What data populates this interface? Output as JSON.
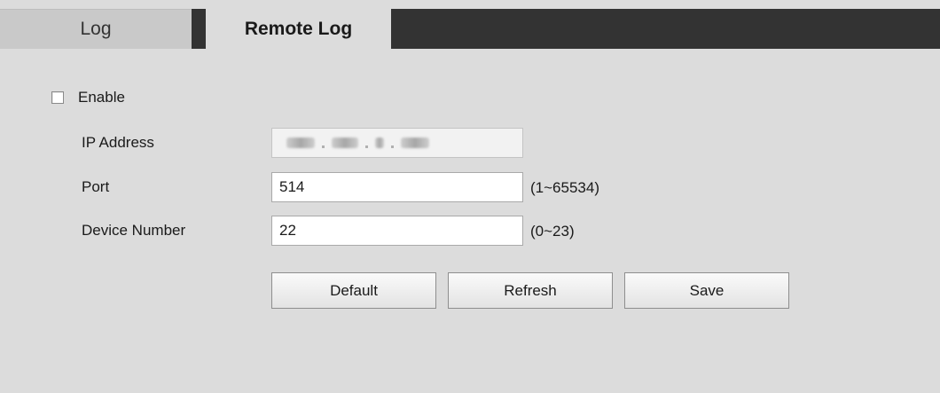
{
  "tabs": {
    "log": "Log",
    "remote_log": "Remote Log"
  },
  "form": {
    "enable_label": "Enable",
    "enable_checked": false,
    "ip_label": "IP Address",
    "port_label": "Port",
    "port_value": "514",
    "port_range": "(1~65534)",
    "device_label": "Device Number",
    "device_value": "22",
    "device_range": "(0~23)"
  },
  "buttons": {
    "default": "Default",
    "refresh": "Refresh",
    "save": "Save"
  }
}
